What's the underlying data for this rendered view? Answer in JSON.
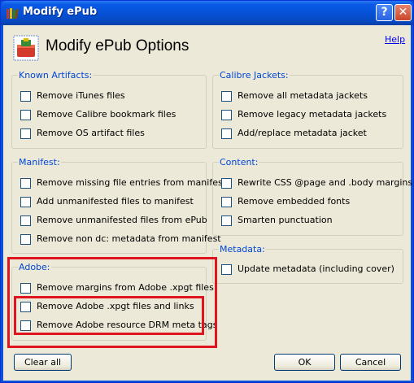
{
  "window": {
    "title": "Modify ePub"
  },
  "header": {
    "title": "Modify ePub Options",
    "help_link": "Help"
  },
  "groups": {
    "known_artifacts": {
      "legend": "Known Artifacts:",
      "options": [
        "Remove iTunes files",
        "Remove Calibre bookmark files",
        "Remove OS artifact files"
      ]
    },
    "calibre_jackets": {
      "legend": "Calibre Jackets:",
      "options": [
        "Remove all metadata jackets",
        "Remove legacy metadata jackets",
        "Add/replace metadata jacket"
      ]
    },
    "manifest": {
      "legend": "Manifest:",
      "options": [
        "Remove missing file entries from manifest",
        "Add unmanifested files to manifest",
        "Remove unmanifested files from ePub",
        "Remove non dc: metadata from manifest"
      ]
    },
    "content": {
      "legend": "Content:",
      "options": [
        "Rewrite CSS @page and .body margins",
        "Remove embedded fonts",
        "Smarten punctuation"
      ]
    },
    "metadata": {
      "legend": "Metadata:",
      "options": [
        "Update metadata (including cover)"
      ]
    },
    "adobe": {
      "legend": "Adobe:",
      "options": [
        "Remove margins from Adobe .xpgt files",
        "Remove Adobe .xpgt files and links",
        "Remove Adobe resource DRM meta tags"
      ]
    }
  },
  "buttons": {
    "clear_all": "Clear all",
    "ok": "OK",
    "cancel": "Cancel"
  },
  "colors": {
    "highlight": "#e0141e",
    "legend_text": "#0046d5",
    "titlebar": "#0550d4"
  }
}
